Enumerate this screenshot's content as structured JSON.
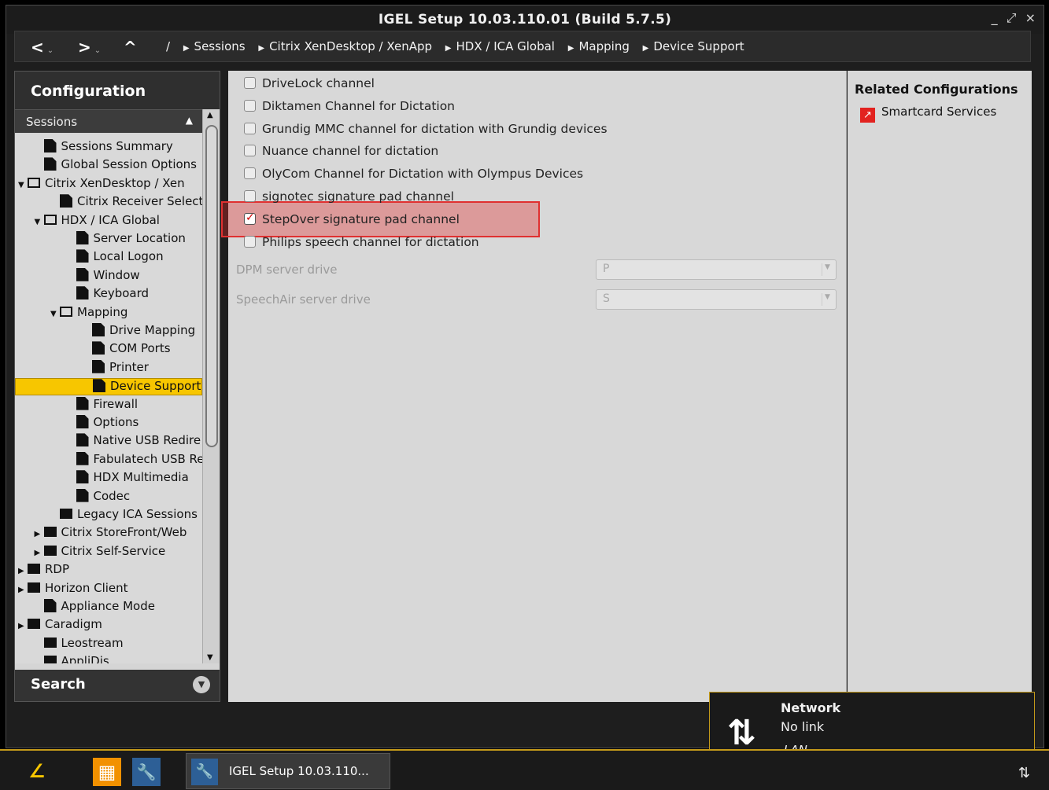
{
  "window": {
    "title": "IGEL Setup 10.03.110.01 (Build 5.7.5)",
    "controls": [
      "_",
      "⤢",
      "×"
    ]
  },
  "nav": {
    "back": "<",
    "forward": ">",
    "up": "^",
    "root": "/",
    "breadcrumb": [
      "Sessions",
      "Citrix XenDesktop / XenApp",
      "HDX / ICA Global",
      "Mapping",
      "Device Support"
    ]
  },
  "sidebar": {
    "header": "Configuration",
    "section": "Sessions",
    "tree": [
      {
        "label": "Sessions Summary",
        "indent": 1,
        "kind": "doc"
      },
      {
        "label": "Global Session Options",
        "indent": 1,
        "kind": "doc"
      },
      {
        "label": "Citrix XenDesktop / Xen",
        "indent": 0,
        "kind": "fold-open",
        "expander": "▼"
      },
      {
        "label": "Citrix Receiver Select",
        "indent": 2,
        "kind": "doc"
      },
      {
        "label": "HDX / ICA Global",
        "indent": 1,
        "kind": "fold-open",
        "expander": "▼"
      },
      {
        "label": "Server Location",
        "indent": 3,
        "kind": "doc"
      },
      {
        "label": "Local Logon",
        "indent": 3,
        "kind": "doc"
      },
      {
        "label": "Window",
        "indent": 3,
        "kind": "doc"
      },
      {
        "label": "Keyboard",
        "indent": 3,
        "kind": "doc"
      },
      {
        "label": "Mapping",
        "indent": 2,
        "kind": "fold-open",
        "expander": "▼"
      },
      {
        "label": "Drive Mapping",
        "indent": 4,
        "kind": "doc"
      },
      {
        "label": "COM Ports",
        "indent": 4,
        "kind": "doc"
      },
      {
        "label": "Printer",
        "indent": 4,
        "kind": "doc"
      },
      {
        "label": "Device Support",
        "indent": 4,
        "kind": "doc",
        "selected": true
      },
      {
        "label": "Firewall",
        "indent": 3,
        "kind": "doc"
      },
      {
        "label": "Options",
        "indent": 3,
        "kind": "doc"
      },
      {
        "label": "Native USB Redire",
        "indent": 3,
        "kind": "doc"
      },
      {
        "label": "Fabulatech USB Re",
        "indent": 3,
        "kind": "doc"
      },
      {
        "label": "HDX Multimedia",
        "indent": 3,
        "kind": "doc"
      },
      {
        "label": "Codec",
        "indent": 3,
        "kind": "doc"
      },
      {
        "label": "Legacy ICA Sessions",
        "indent": 2,
        "kind": "fold-closed"
      },
      {
        "label": "Citrix StoreFront/Web",
        "indent": 1,
        "kind": "fold-closed",
        "expander": "▶"
      },
      {
        "label": "Citrix Self-Service",
        "indent": 1,
        "kind": "fold-closed",
        "expander": "▶"
      },
      {
        "label": "RDP",
        "indent": 0,
        "kind": "fold-closed",
        "expander": "▶"
      },
      {
        "label": "Horizon Client",
        "indent": 0,
        "kind": "fold-closed",
        "expander": "▶"
      },
      {
        "label": "Appliance Mode",
        "indent": 1,
        "kind": "doc"
      },
      {
        "label": "Caradigm",
        "indent": 0,
        "kind": "fold-closed",
        "expander": "▶"
      },
      {
        "label": "Leostream",
        "indent": 1,
        "kind": "fold-closed"
      },
      {
        "label": "AppliDis",
        "indent": 1,
        "kind": "fold-closed"
      }
    ],
    "search": "Search"
  },
  "options": [
    {
      "label": "DriveLock channel",
      "checked": false
    },
    {
      "label": "Diktamen Channel for Dictation",
      "checked": false
    },
    {
      "label": "Grundig MMC channel for dictation with Grundig devices",
      "checked": false
    },
    {
      "label": "Nuance channel for dictation",
      "checked": false
    },
    {
      "label": "OlyCom Channel for Dictation with Olympus Devices",
      "checked": false
    },
    {
      "label": "signotec signature pad channel",
      "checked": false
    },
    {
      "label": "StepOver signature pad channel",
      "checked": true
    },
    {
      "label": "Philips speech channel for dictation",
      "checked": false
    }
  ],
  "fields": {
    "dpm_label": "DPM server drive",
    "dpm_value": "P",
    "speechair_label": "SpeechAir server drive",
    "speechair_value": "S"
  },
  "related": {
    "title": "Related Configurations",
    "link": "Smartcard Services"
  },
  "notification": {
    "title": "Network",
    "status": "No link",
    "type": "LAN"
  },
  "taskbar": {
    "task_label": "IGEL Setup 10.03.110..."
  },
  "colors": {
    "accent": "#f7c600",
    "highlight": "#e03030",
    "related_link_icon": "#e2221f"
  }
}
